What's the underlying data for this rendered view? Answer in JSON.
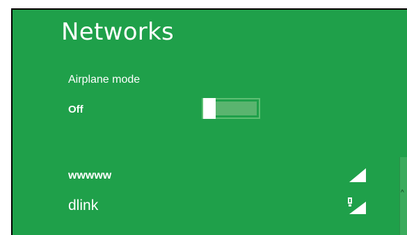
{
  "panel": {
    "title": "Networks",
    "background_color": "#1fa04a"
  },
  "airplane_mode": {
    "label": "Airplane mode",
    "state": "Off"
  },
  "networks": [
    {
      "name": "wwwww",
      "icon": "wifi-signal-icon"
    },
    {
      "name": "dlink",
      "icon": "wifi-signal-secured-icon"
    }
  ]
}
